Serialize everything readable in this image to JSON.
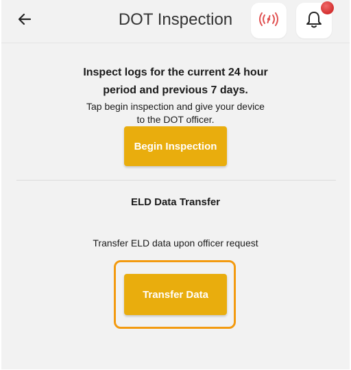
{
  "header": {
    "title": "DOT Inspection",
    "back_icon": "arrow-left-icon",
    "signal_icon": "broadcast-signal-icon",
    "bell_icon": "bell-icon"
  },
  "inspection": {
    "line1": "Inspect logs for the current 24 hour",
    "line2": "period and previous 7 days.",
    "instruction_line1": "Tap begin inspection and give your device",
    "instruction_line2": "to the DOT officer.",
    "begin_button": "Begin Inspection"
  },
  "eld_transfer": {
    "title": "ELD Data Transfer",
    "description": "Transfer ELD data upon officer request",
    "transfer_button": "Transfer Data"
  },
  "colors": {
    "accent": "#e9ad0d",
    "highlight": "#f39a0f",
    "signal": "#e05252",
    "notification": "#d32f2f",
    "background": "#f2f2f2"
  }
}
